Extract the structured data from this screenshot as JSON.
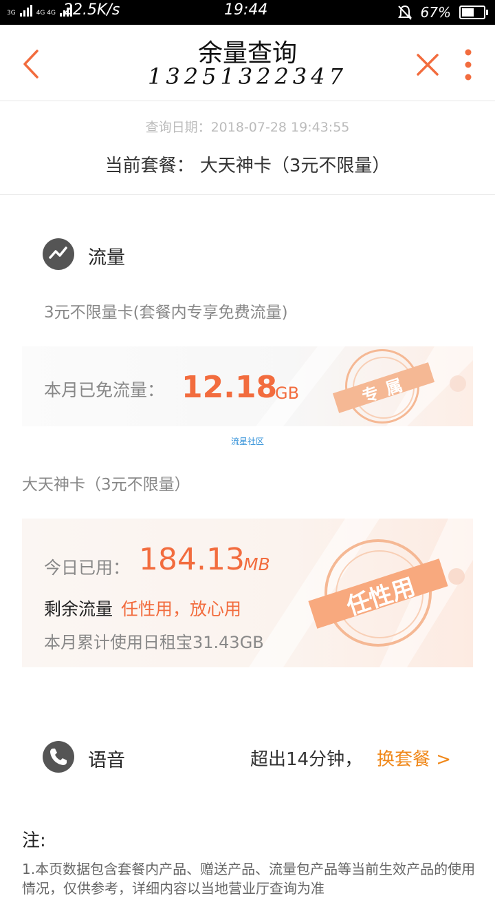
{
  "status_bar": {
    "net_label_a": "3G",
    "net_label_b": "4G 4G",
    "speed": "22.5K/s",
    "time": "19:44",
    "battery": "67%",
    "battery_level": 0.67
  },
  "header": {
    "title": "余量查询",
    "phone": "13251322347"
  },
  "query_date": "查询日期：2018-07-28 19:43:55",
  "current_plan": "当前套餐： 大天神卡（3元不限量）",
  "data_section": {
    "label": "流量",
    "subtitle": "3元不限量卡(套餐内专享免费流量)",
    "free_label": "本月已免流量：",
    "free_value": "12.18",
    "free_unit": "GB",
    "stamp1": "专属",
    "link": "流星社区"
  },
  "plan_section": {
    "title": "大天神卡（3元不限量）",
    "today_label": "今日已用：",
    "today_value": "184.13",
    "today_unit": "MB",
    "remain_prefix": "剩余流量",
    "remain_highlight": "任性用，放心用",
    "monthly": "本月累计使用日租宝31.43GB",
    "stamp2": "任性用"
  },
  "voice_section": {
    "label": "语音",
    "exceed": "超出14分钟，",
    "change": "换套餐 >"
  },
  "notes": {
    "title": "注:",
    "text": "1.本页数据包含套餐内产品、赠送产品、流量包产品等当前生效产品的使用情况，仅供参考，详细内容以当地营业厅查询为准"
  },
  "colors": {
    "accent": "#f26c3e",
    "icon_gray": "#555555"
  }
}
